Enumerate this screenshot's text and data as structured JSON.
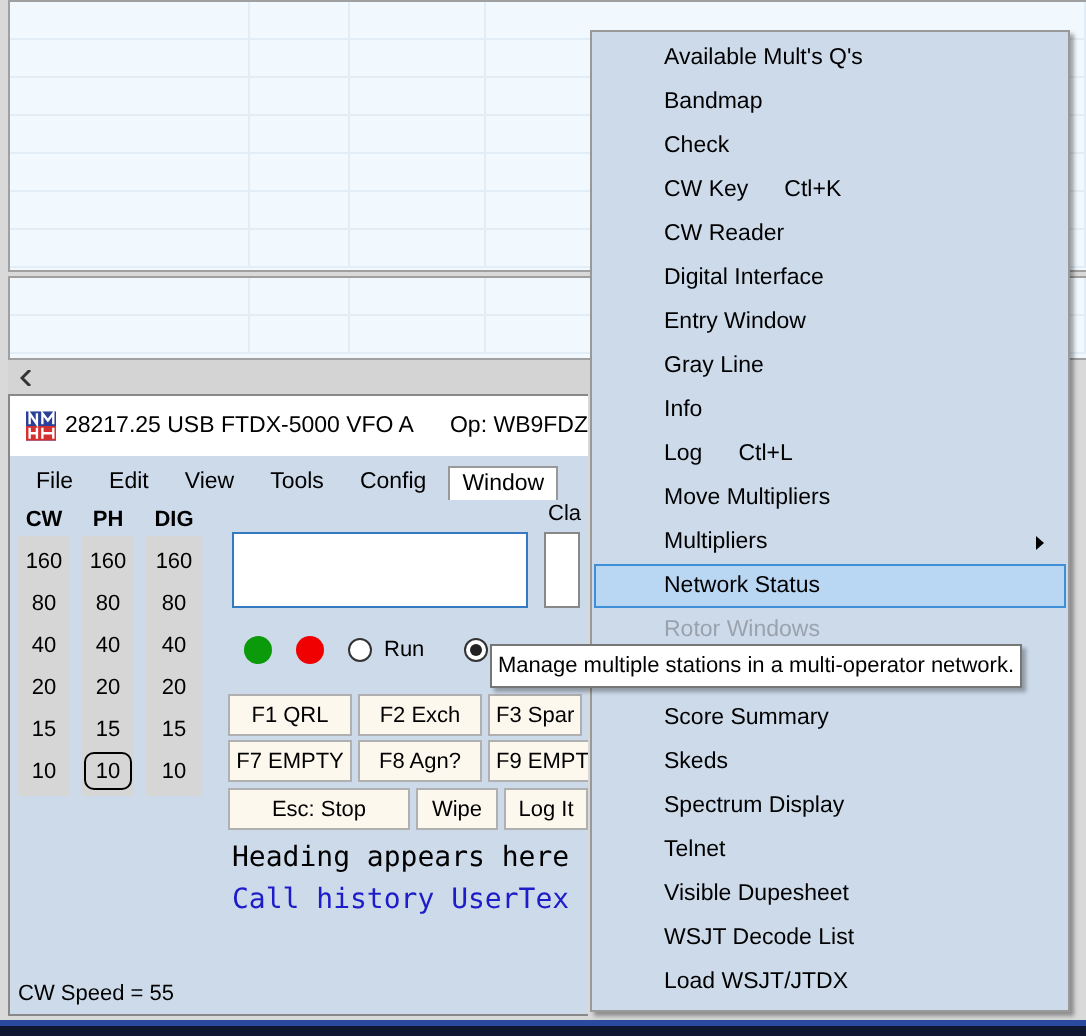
{
  "entry_window": {
    "title": "28217.25 USB FTDX-5000 VFO A",
    "operator": "Op: WB9FDZ",
    "menu_bar": [
      {
        "label": "File",
        "selected": false
      },
      {
        "label": "Edit",
        "selected": false
      },
      {
        "label": "View",
        "selected": false
      },
      {
        "label": "Tools",
        "selected": false
      },
      {
        "label": "Config",
        "selected": false
      },
      {
        "label": "Window",
        "selected": true
      }
    ],
    "band_columns": [
      {
        "header": "CW",
        "bands": [
          {
            "label": "160",
            "selected": false
          },
          {
            "label": "80",
            "selected": false
          },
          {
            "label": "40",
            "selected": false
          },
          {
            "label": "20",
            "selected": false
          },
          {
            "label": "15",
            "selected": false
          },
          {
            "label": "10",
            "selected": false
          }
        ]
      },
      {
        "header": "PH",
        "bands": [
          {
            "label": "160",
            "selected": false
          },
          {
            "label": "80",
            "selected": false
          },
          {
            "label": "40",
            "selected": false
          },
          {
            "label": "20",
            "selected": false
          },
          {
            "label": "15",
            "selected": false
          },
          {
            "label": "10",
            "selected": true
          }
        ]
      },
      {
        "header": "DIG",
        "bands": [
          {
            "label": "160",
            "selected": false
          },
          {
            "label": "80",
            "selected": false
          },
          {
            "label": "40",
            "selected": false
          },
          {
            "label": "20",
            "selected": false
          },
          {
            "label": "15",
            "selected": false
          },
          {
            "label": "10",
            "selected": false
          }
        ]
      }
    ],
    "class_label": "Cla",
    "status_dots": [
      {
        "color": "#0a9a0a"
      },
      {
        "color": "#f00000"
      }
    ],
    "radios": [
      {
        "label": "Run",
        "checked": false
      },
      {
        "checked": true
      }
    ],
    "function_keys": [
      [
        "F1 QRL",
        "F2 Exch",
        "F3 Spar"
      ],
      [
        "F7 EMPTY",
        "F8 Agn?",
        "F9 EMPT"
      ],
      [
        "Esc: Stop",
        "Wipe",
        "Log It"
      ]
    ],
    "heading": "Heading appears here",
    "call_history": "Call history UserTex",
    "status_bar": "CW Speed = 55"
  },
  "window_menu": {
    "items": [
      {
        "label": "Available Mult's  Q's",
        "selected": false,
        "disabled": false
      },
      {
        "label": "Bandmap",
        "selected": false,
        "disabled": false
      },
      {
        "label": "Check",
        "selected": false,
        "disabled": false
      },
      {
        "label": "CW Key",
        "shortcut": "Ctl+K",
        "selected": false,
        "disabled": false
      },
      {
        "label": "CW Reader",
        "selected": false,
        "disabled": false
      },
      {
        "label": "Digital Interface",
        "selected": false,
        "disabled": false
      },
      {
        "label": "Entry Window",
        "selected": false,
        "disabled": false
      },
      {
        "label": "Gray Line",
        "selected": false,
        "disabled": false
      },
      {
        "label": "Info",
        "selected": false,
        "disabled": false
      },
      {
        "label": "Log",
        "shortcut": "Ctl+L",
        "selected": false,
        "disabled": false
      },
      {
        "label": "Move Multipliers",
        "selected": false,
        "disabled": false
      },
      {
        "label": "Multipliers",
        "submenu": true,
        "selected": false,
        "disabled": false
      },
      {
        "label": "Network Status",
        "selected": true,
        "disabled": false
      },
      {
        "label": "Rotor Windows",
        "selected": false,
        "disabled": true
      },
      {
        "label": "Score Summary",
        "selected": false,
        "disabled": false
      },
      {
        "label": "Skeds",
        "selected": false,
        "disabled": false
      },
      {
        "label": "Spectrum Display",
        "selected": false,
        "disabled": false
      },
      {
        "label": "Telnet",
        "selected": false,
        "disabled": false
      },
      {
        "label": "Visible Dupesheet",
        "selected": false,
        "disabled": false
      },
      {
        "label": "WSJT Decode List",
        "selected": false,
        "disabled": false
      },
      {
        "label": "Load WSJT/JTDX",
        "selected": false,
        "disabled": false
      }
    ]
  },
  "tooltip": "Manage multiple stations in a multi-operator network."
}
